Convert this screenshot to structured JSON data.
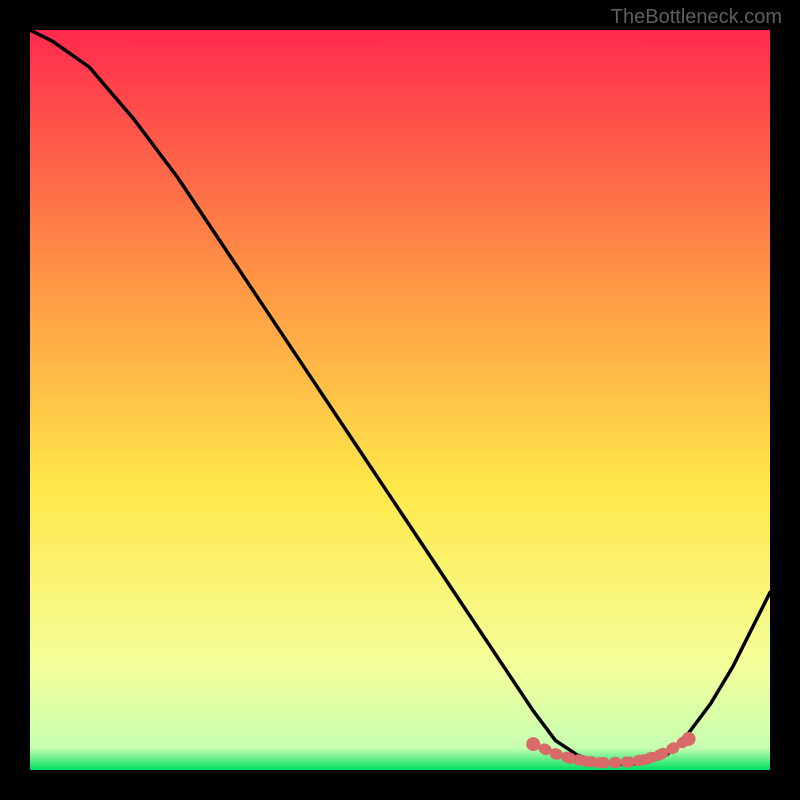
{
  "watermark": "TheBottleneck.com",
  "chart_data": {
    "type": "line",
    "title": "",
    "xlabel": "",
    "ylabel": "",
    "xlim": [
      0,
      100
    ],
    "ylim": [
      0,
      100
    ],
    "background_gradient": {
      "top": "#ff2a4d",
      "mid1": "#ff9944",
      "mid2": "#ffe84a",
      "low": "#f4ff9a",
      "bottom": "#00e060"
    },
    "series": [
      {
        "name": "main-curve",
        "color": "#000000",
        "x": [
          0,
          3,
          8,
          14,
          20,
          26,
          32,
          38,
          44,
          50,
          56,
          62,
          68,
          71,
          74,
          77,
          80,
          83,
          86,
          89,
          92,
          95,
          98,
          100
        ],
        "y": [
          100,
          98.5,
          95,
          88,
          80,
          71,
          62,
          53,
          44,
          35,
          26,
          17,
          8,
          4,
          2,
          1,
          0.8,
          0.9,
          2,
          5,
          9,
          14,
          20,
          24
        ]
      },
      {
        "name": "highlight-dots",
        "color": "#d86a6a",
        "type": "scatter",
        "x": [
          68,
          71,
          73,
          75,
          77,
          79,
          81,
          83,
          85,
          87,
          89
        ],
        "y": [
          3.5,
          2.2,
          1.6,
          1.2,
          1.0,
          1.0,
          1.1,
          1.4,
          2.0,
          3.0,
          4.2
        ]
      }
    ]
  }
}
